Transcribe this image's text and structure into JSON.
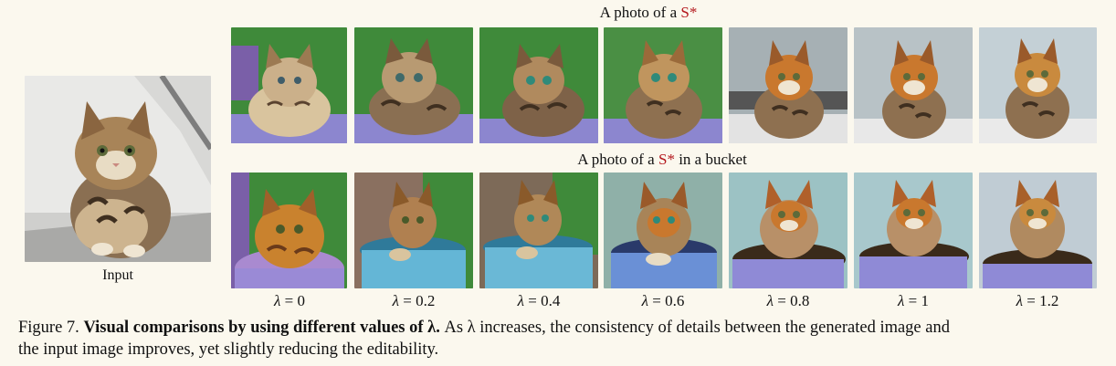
{
  "figure": {
    "prompt_top_prefix": "A photo of a",
    "prompt_top_token": "S*",
    "prompt_bottom_prefix": "A photo of a",
    "prompt_bottom_token": "S*",
    "prompt_bottom_suffix": "in a bucket",
    "input_label": "Input",
    "lambda_symbol": "λ",
    "lambda_values": [
      "= 0",
      "= 0.2",
      "= 0.4",
      "= 0.6",
      "= 0.8",
      "= 1",
      "= 1.2"
    ],
    "caption_label": "Figure 7.",
    "caption_bold": "Visual comparisons by using different values of λ.",
    "caption_line1_rest": "As λ increases, the consistency of details between the generated image and",
    "caption_line2": "the input image improves, yet slightly reducing the editability.",
    "colors": {
      "token": "#b3161b",
      "background": "#fbf8ee",
      "fur_light": "#e6cfa6",
      "fur_dark": "#5a4330",
      "orange": "#c9782e",
      "green_bg": "#3f8a3a",
      "purple_floor": "#8c86cf",
      "grey_bg": "#b8c2c6",
      "bucket_blue": "#64b6d6",
      "bucket_purple": "#8f8ad6"
    }
  }
}
